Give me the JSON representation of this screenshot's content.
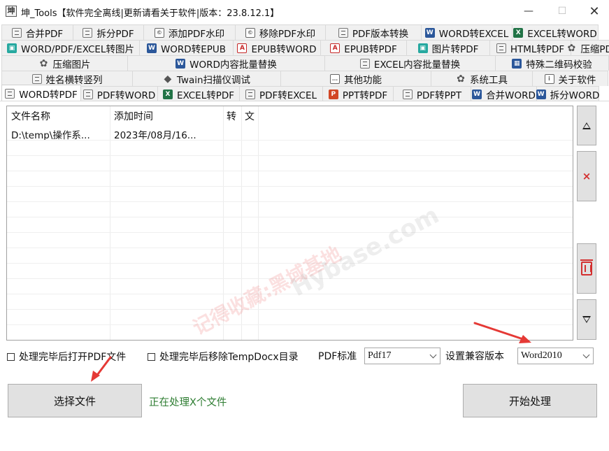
{
  "window": {
    "title": "坤_Tools【软件完全离线|更新请看关于软件|版本：23.8.12.1】",
    "minimize": "—",
    "maximize": "☐",
    "close": "✕"
  },
  "tabs": {
    "row1": [
      {
        "label": "合并PDF",
        "icon": "document-icon"
      },
      {
        "label": "拆分PDF",
        "icon": "document-icon"
      },
      {
        "label": "添加PDF水印",
        "icon": "watermark-icon"
      },
      {
        "label": "移除PDF水印",
        "icon": "watermark-icon"
      },
      {
        "label": "PDF版本转换",
        "icon": "document-icon"
      },
      {
        "label": "WORD转EXCEL",
        "icon": "word-icon"
      },
      {
        "label": "EXCEL转WORD",
        "icon": "excel-icon"
      }
    ],
    "row2": [
      {
        "label": "WORD/PDF/EXCEL转图片",
        "icon": "image-icon"
      },
      {
        "label": "WORD转EPUB",
        "icon": "word-icon"
      },
      {
        "label": "EPUB转WORD",
        "icon": "pdf-icon"
      },
      {
        "label": "EPUB转PDF",
        "icon": "pdf-icon"
      },
      {
        "label": "图片转PDF",
        "icon": "image-icon"
      },
      {
        "label": "HTML转PDF",
        "icon": "document-icon"
      },
      {
        "label": "压缩PDF",
        "icon": "gear-icon"
      }
    ],
    "row3": [
      {
        "label": "压缩图片",
        "icon": "gear-icon"
      },
      {
        "label": "WORD内容批量替换",
        "icon": "word-icon"
      },
      {
        "label": "EXCEL内容批量替换",
        "icon": "document-icon"
      },
      {
        "label": "特殊二维码校验",
        "icon": "qrcode-icon"
      }
    ],
    "row4": [
      {
        "label": "姓名横转竖列",
        "icon": "list-icon"
      },
      {
        "label": "Twain扫描仪调试",
        "icon": "scanner-icon"
      },
      {
        "label": "其他功能",
        "icon": "more-icon"
      },
      {
        "label": "系统工具",
        "icon": "gear-icon"
      },
      {
        "label": "关于软件",
        "icon": "info-icon"
      }
    ],
    "row5": [
      {
        "label": "WORD转PDF",
        "icon": "document-icon",
        "active": true
      },
      {
        "label": "PDF转WORD",
        "icon": "document-icon"
      },
      {
        "label": "EXCEL转PDF",
        "icon": "excel-icon"
      },
      {
        "label": "PDF转EXCEL",
        "icon": "document-icon"
      },
      {
        "label": "PPT转PDF",
        "icon": "ppt-icon"
      },
      {
        "label": "PDF转PPT",
        "icon": "document-icon"
      },
      {
        "label": "合并WORD",
        "icon": "word-icon"
      },
      {
        "label": "拆分WORD",
        "icon": "word-icon"
      }
    ]
  },
  "filelist": {
    "columns": [
      "文件名称",
      "添加时间",
      "转",
      "文"
    ],
    "rows": [
      {
        "name": "D:\\temp\\操作系...",
        "time": "2023年/08月/16..."
      }
    ]
  },
  "watermark": {
    "red": "记得收藏:黑域基地",
    "gray": "Hybase.com"
  },
  "side_buttons": {
    "delete": "×"
  },
  "options": {
    "open_pdf_after": "处理完毕后打开PDF文件",
    "remove_temp_dir": "处理完毕后移除TempDocx目录",
    "pdf_standard_label": "PDF标准",
    "pdf_standard_value": "Pdf17",
    "compat_label": "设置兼容版本",
    "compat_value": "Word2010"
  },
  "actions": {
    "select_files": "选择文件",
    "status": "正在处理X个文件",
    "start": "开始处理"
  },
  "colors": {
    "status_text": "#2e7d32",
    "arrow": "#e53935",
    "delete_icon": "#d32f2f"
  }
}
